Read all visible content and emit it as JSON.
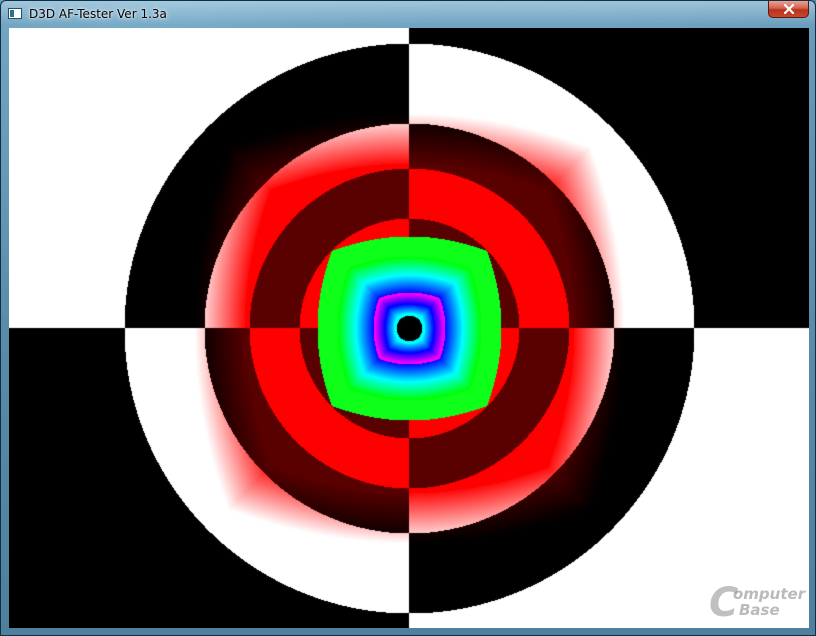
{
  "window": {
    "title": "D3D AF-Tester Ver 1.3a",
    "icon": "app-window-icon",
    "close_icon": "close-icon"
  },
  "render": {
    "description_icon": "af-tunnel-render",
    "colors": {
      "black": "#000000",
      "white": "#ffffff",
      "mip_red": "#ff0000",
      "mip_green": "#00ff00",
      "mip_blue": "#0000ff",
      "mip_magenta": "#ff00ff",
      "mip_cyan": "#00ffff"
    }
  },
  "watermark": {
    "letter": "C",
    "line1": "omputer",
    "line2": "Base"
  }
}
